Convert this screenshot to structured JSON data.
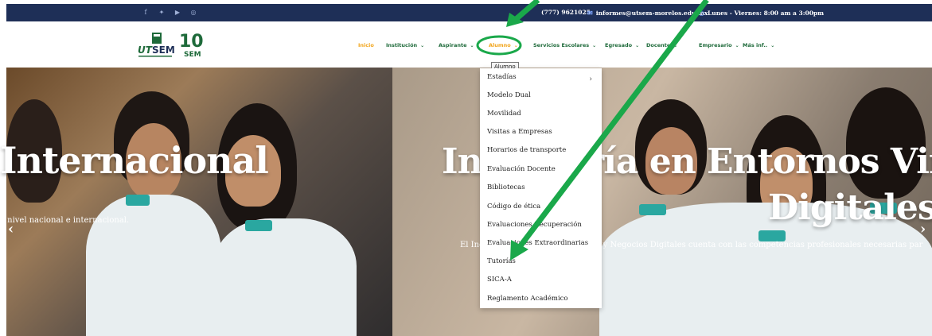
{
  "topbar": {
    "social_icons": [
      "facebook-icon",
      "twitter-icon",
      "youtube-icon",
      "whatsapp-icon"
    ],
    "phone": "(777) 9621025",
    "email": "informes@utsem-morelos.edu.mx",
    "hours": "Lunes - Viernes: 8:00 am a 3:00pm"
  },
  "nav": {
    "items": [
      {
        "label": "Inicio",
        "has_dropdown": false
      },
      {
        "label": "Institución",
        "has_dropdown": true
      },
      {
        "label": "Aspirante",
        "has_dropdown": true
      },
      {
        "label": "Alumno",
        "has_dropdown": true
      },
      {
        "label": "Servicios Escolares",
        "has_dropdown": true
      },
      {
        "label": "Egresado",
        "has_dropdown": true
      },
      {
        "label": "Docente",
        "has_dropdown": true
      },
      {
        "label": "Empresario",
        "has_dropdown": true
      },
      {
        "label": "Más inf..",
        "has_dropdown": true
      }
    ]
  },
  "tooltip": "Alumno",
  "dropdown": {
    "items": [
      "Estadías",
      "Modelo Dual",
      "Movilidad",
      "Visitas a Empresas",
      "Horarios de transporte",
      "Evaluación Docente",
      "Bibliotecas",
      "Código de ética",
      "Evaluaciones Recuperación",
      "Evaluaciones Extraordinarias",
      "Tutorías",
      "SICA-A",
      "Reglamento Académico"
    ]
  },
  "hero": {
    "left_title": "Internacional",
    "left_subtitle": "a nivel nacional e internacional.",
    "right_title_line1": "Ingeniería en Entornos Vir",
    "right_title_line2": "Digitales",
    "right_subtitle": "El Ingeniero en Entornos Virtuales y Negocios Digitales cuenta con las competencias profesionales necesarias par"
  },
  "colors": {
    "topbar_bg": "#1e2f57",
    "nav_text": "#1e6a3a",
    "nav_active": "#f2a51c",
    "annotation_green": "#1aa84a"
  }
}
